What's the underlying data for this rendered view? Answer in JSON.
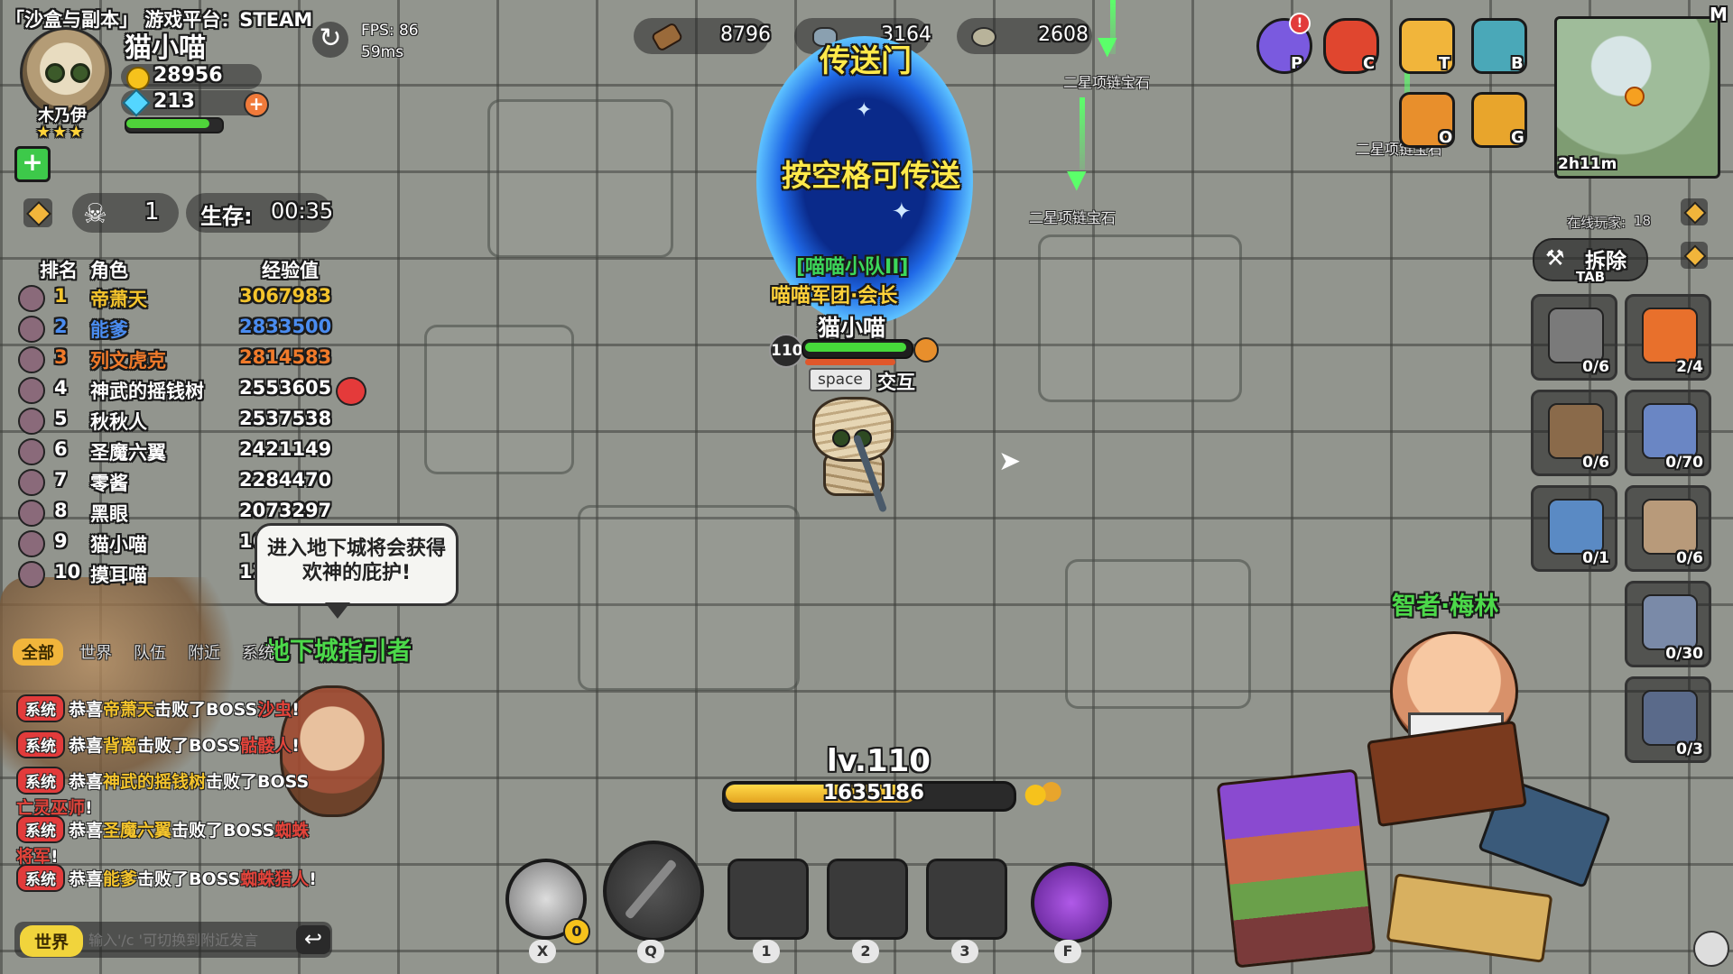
{
  "stream_title": "「沙盒与副本」 游戏平台：STEAM",
  "player": {
    "name": "猫小喵",
    "avatar_name": "木乃伊",
    "stars": "★★★",
    "gold": "28956",
    "gems": "213",
    "fps": "FPS: 86",
    "ping": "59ms",
    "hp_fraction": 0.88
  },
  "stats": {
    "kills": "1",
    "survive_label": "生存:",
    "survive_time": "00:35"
  },
  "leaderboard": {
    "headers": [
      "排名",
      "角色",
      "经验值"
    ],
    "rows": [
      {
        "rank": "1",
        "name": "帝萧天",
        "exp": "3067983",
        "color": "#f4c42c"
      },
      {
        "rank": "2",
        "name": "能爹",
        "exp": "2833500",
        "color": "#4a8cf0"
      },
      {
        "rank": "3",
        "name": "列文虎克",
        "exp": "2814583",
        "color": "#f07a2a"
      },
      {
        "rank": "4",
        "name": "神武的摇钱树",
        "exp": "2553605",
        "color": "#ffffff"
      },
      {
        "rank": "5",
        "name": "秋秋人",
        "exp": "2537538",
        "color": "#ffffff"
      },
      {
        "rank": "6",
        "name": "圣魔六翼",
        "exp": "2421149",
        "color": "#ffffff"
      },
      {
        "rank": "7",
        "name": "零酱",
        "exp": "2284470",
        "color": "#ffffff"
      },
      {
        "rank": "8",
        "name": "黑眼",
        "exp": "2073297",
        "color": "#ffffff"
      },
      {
        "rank": "9",
        "name": "猫小喵",
        "exp": "1635186",
        "color": "#ffffff"
      },
      {
        "rank": "10",
        "name": "摸耳喵",
        "exp": "1226",
        "color": "#ffffff"
      }
    ]
  },
  "npc_bubble": {
    "line1": "进入地下城将会获得",
    "line2": "欢神的庇护!"
  },
  "npc_guide": "地下城指引者",
  "chat": {
    "tabs": [
      "全部",
      "世界",
      "队伍",
      "附近",
      "系统"
    ],
    "messages": [
      {
        "badge": "系统",
        "pre": "恭喜",
        "who": "帝萧天",
        "mid": "击败了BOSS",
        "boss": "沙虫",
        "end": "!"
      },
      {
        "badge": "系统",
        "pre": "恭喜",
        "who": "背离",
        "mid": "击败了BOSS",
        "boss": "骷髅人",
        "end": "!"
      },
      {
        "badge": "系统",
        "pre": "恭喜",
        "who": "神武的摇钱树",
        "mid": "击败了BOSS",
        "boss": "亡灵巫师",
        "end": "!"
      },
      {
        "badge": "系统",
        "pre": "恭喜",
        "who": "圣魔六翼",
        "mid": "击败了BOSS",
        "boss": "蜘蛛将军",
        "end": "!"
      },
      {
        "badge": "系统",
        "pre": "恭喜",
        "who": "能爹",
        "mid": "击败了BOSS",
        "boss": "蜘蛛猎人",
        "end": "!"
      }
    ],
    "channel": "世界",
    "input_placeholder": "输入'/c '可切换到附近发言"
  },
  "resources": [
    {
      "icon": "wood-icon",
      "value": "8796"
    },
    {
      "icon": "ore-icon",
      "value": "3164"
    },
    {
      "icon": "stone-icon",
      "value": "2608"
    }
  ],
  "portal": {
    "label": "传送门",
    "hint": "按空格可传送"
  },
  "character": {
    "team": "[喵喵小队II]",
    "guild": "喵喵军团·会长",
    "name": "猫小喵",
    "level": "110",
    "interact_key": "space",
    "interact_label": "交互",
    "hp_fraction": 0.93
  },
  "drops": [
    {
      "label": "二星项链宝石"
    },
    {
      "label": "二星项链宝石"
    },
    {
      "label": "二星项链宝石"
    }
  ],
  "menu": [
    {
      "icon": "character-icon",
      "key": "P"
    },
    {
      "icon": "pet-cat-icon",
      "key": "C"
    },
    {
      "icon": "talent-flag-icon",
      "key": "T"
    },
    {
      "icon": "backpack-icon",
      "key": "B"
    },
    {
      "icon": "chest-icon",
      "key": "O"
    },
    {
      "icon": "guild-badge-icon",
      "key": "G"
    }
  ],
  "notif": "!",
  "minimap": {
    "key": "M",
    "time": "2h11m",
    "online_label": "在线玩家:",
    "online_count": "18"
  },
  "demolish": {
    "label": "拆除",
    "key": "TAB"
  },
  "buildings": [
    {
      "icon": "upgrade-icon",
      "count": "0/6"
    },
    {
      "icon": "campfire-icon",
      "count": "2/4"
    },
    {
      "icon": "gear-trap-icon",
      "count": "0/6"
    },
    {
      "icon": "stone-wall-icon",
      "count": "0/70"
    },
    {
      "icon": "ice-door-icon",
      "count": "0/1"
    },
    {
      "icon": "spike-fence-icon",
      "count": "0/6"
    },
    {
      "icon": "rock-pillar-icon",
      "count": "0/30"
    },
    {
      "icon": "metal-door-icon",
      "count": "0/3"
    }
  ],
  "exp": {
    "level": "lv.110",
    "value": "1635186",
    "fraction": 0.66
  },
  "skills": [
    {
      "icon": "summon-spirit-icon",
      "key": "X",
      "count": "0"
    },
    {
      "icon": "pickaxe-icon",
      "key": "Q"
    },
    {
      "icon": "empty-slot",
      "key": "1"
    },
    {
      "icon": "empty-slot",
      "key": "2"
    },
    {
      "icon": "empty-slot",
      "key": "3"
    },
    {
      "icon": "purple-beetle-icon",
      "key": "F"
    }
  ],
  "merlin": {
    "name": "智者·梅林"
  },
  "colors": {
    "accent_gold": "#f1b53b",
    "system_red": "#e23b3b",
    "npc_green": "#4cd94a",
    "portal_blue": "#1f68e6"
  }
}
